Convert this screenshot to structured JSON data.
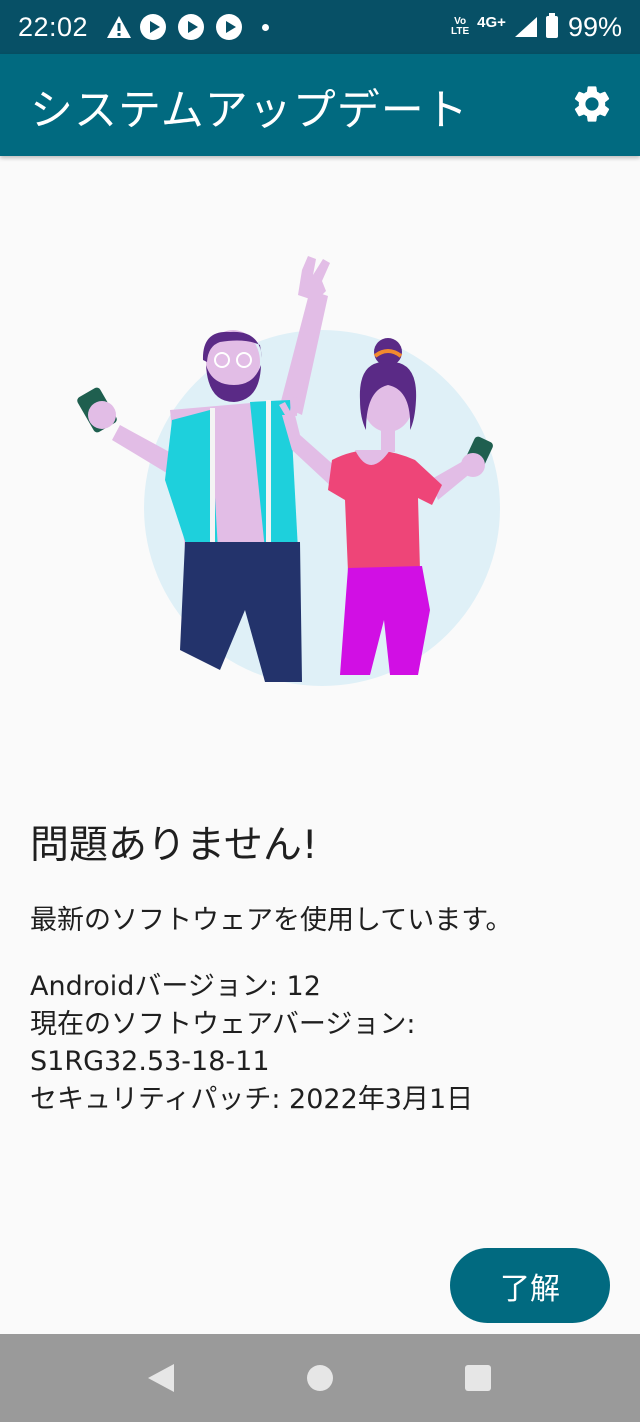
{
  "status_bar": {
    "time": "22:02",
    "notification_icons": [
      "warning-icon",
      "play-icon",
      "play-icon",
      "play-icon",
      "dot-icon"
    ],
    "volte_label_top": "Vo",
    "volte_label_bottom": "LTE",
    "network": "4G+",
    "battery": "99%"
  },
  "app_bar": {
    "title": "システムアップデート",
    "settings_icon": "gear-icon"
  },
  "main": {
    "heading": "問題ありません!",
    "message": "最新のソフトウェアを使用しています。",
    "info_lines": [
      "Androidバージョン: 12",
      "現在のソフトウェアバージョン:",
      "S1RG32.53-18-11",
      "セキュリティパッチ: 2022年3月1日"
    ]
  },
  "actions": {
    "ok_label": "了解"
  },
  "nav_bar": {
    "icons": [
      "back-icon",
      "home-icon",
      "recents-icon"
    ]
  },
  "colors": {
    "status_bar": "#075066",
    "app_bar": "#016a80",
    "button": "#016a80",
    "nav_bar": "#9a9a9a",
    "background": "#fafafa"
  }
}
